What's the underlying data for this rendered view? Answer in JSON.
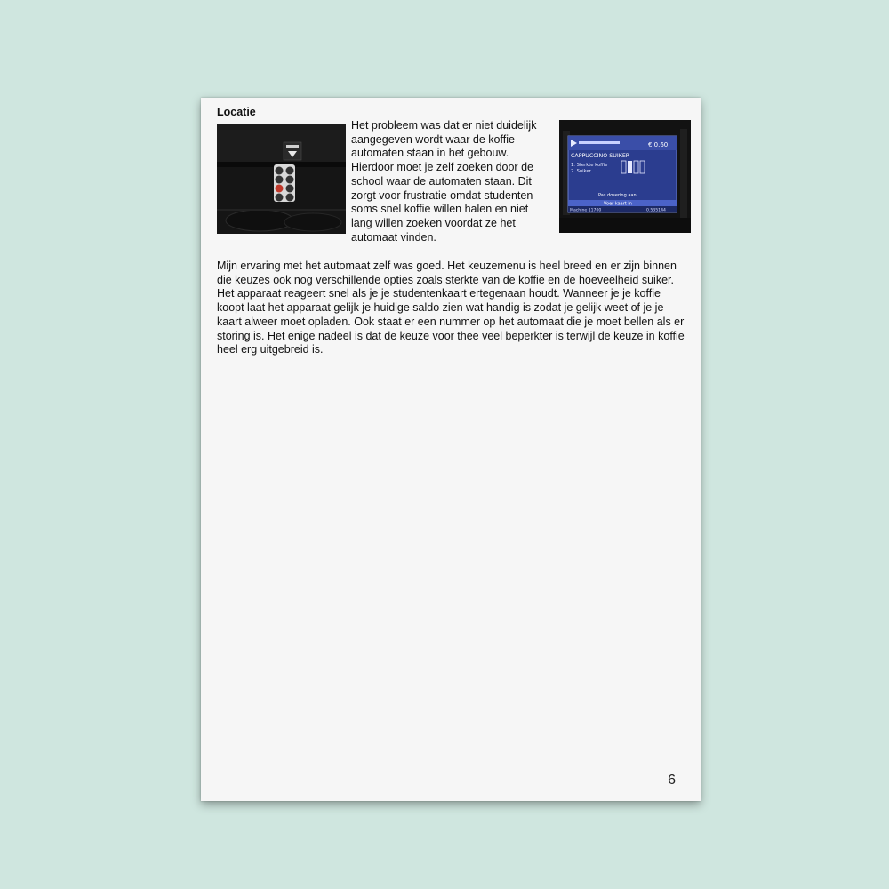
{
  "document": {
    "heading": "Locatie",
    "paragraph_1": "Het probleem was dat er niet duidelijk aangegeven wordt waar de koffie automaten staan in het gebouw. Hierdoor moet je zelf zoeken door de school waar de automaten staan. Dit zorgt voor frustratie omdat studenten soms snel koffie willen halen en niet lang willen zoeken voordat ze het automaat vinden.",
    "paragraph_2": "Mijn ervaring met het automaat zelf was goed. Het keuzemenu is heel breed en er zijn binnen die keuzes ook nog verschillende opties zoals sterkte van de koffie en de hoeveelheid suiker. Het apparaat reageert snel als je je studentenkaart ertegenaan houdt. Wanneer je je koffie koopt laat het apparaat gelijk je huidige saldo zien wat handig is zodat je gelijk weet of je je kaart alweer moet opladen. Ook staat er een nummer op het automaat die je moet bellen als er storing is. Het enige nadeel is dat de keuze voor thee veel beperkter is terwijl de keuze in koffie heel erg uitgebreid is.",
    "page_number": "6"
  },
  "machine_screen": {
    "price": "€ 0.60",
    "product": "CAPPUCCINO SUIKER",
    "option_1": "1. Sterkte koffie",
    "option_2": "2. Suiker",
    "message": "Pas dosering aan",
    "card_prompt": "Voer kaart in",
    "status_left": "Machine 11700",
    "status_right": "0.535144"
  },
  "colors": {
    "background": "#cfe6df",
    "page": "#f6f6f6",
    "screen_blue": "#2b3d8f"
  }
}
